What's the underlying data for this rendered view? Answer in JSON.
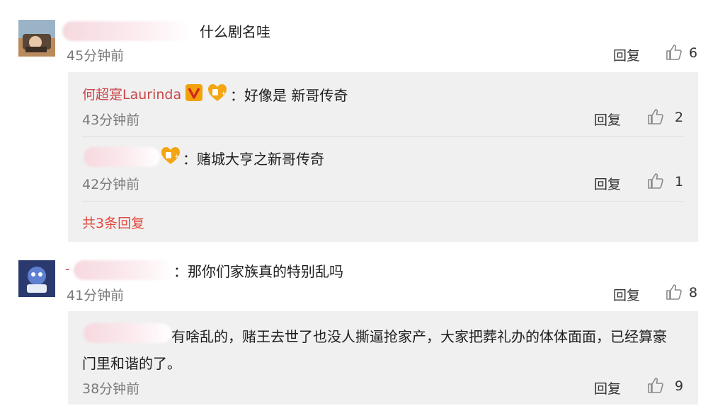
{
  "comments": [
    {
      "text": "什么剧名哇",
      "time": "45分钟前",
      "reply_label": "回复",
      "likes": "6",
      "replies": [
        {
          "username": "何超寔Laurinda",
          "text": "：好像是 新哥传奇",
          "time": "43分钟前",
          "reply_label": "回复",
          "likes": "2"
        },
        {
          "text": "：赌城大亨之新哥传奇",
          "time": "42分钟前",
          "reply_label": "回复",
          "likes": "1"
        }
      ],
      "more_replies": "共3条回复"
    },
    {
      "prefix": "-",
      "text": "：那你们家族真的特别乱吗",
      "time": "41分钟前",
      "reply_label": "回复",
      "likes": "8",
      "replies": [
        {
          "line1": "有啥乱的，赌王去世了也没人撕逼抢家产，大家把葬礼办的体体面面，已经算豪",
          "line2": "门里和谐的了。",
          "time": "38分钟前",
          "reply_label": "回复",
          "likes": "9"
        }
      ]
    }
  ],
  "colors": {
    "panel_bg": "#f0f0f0",
    "username_red": "#c8484b",
    "link_red": "#e2493f",
    "time_gray": "#7a7a7a"
  },
  "icons": [
    "like-thumb-icon",
    "verified-v-icon",
    "fan-badge-icon"
  ]
}
